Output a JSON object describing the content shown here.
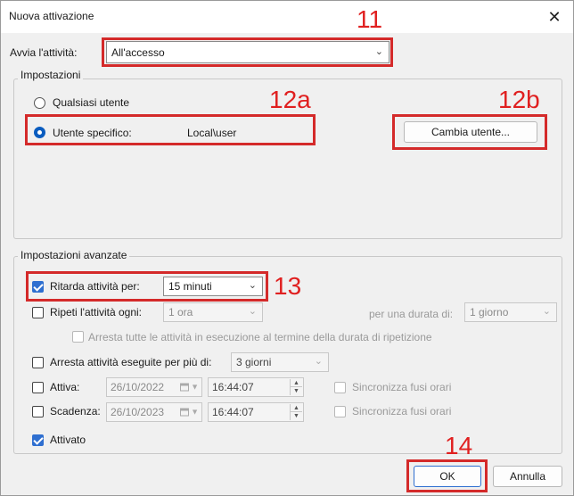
{
  "window": {
    "title": "Nuova attivazione",
    "close_glyph": "✕"
  },
  "start": {
    "label": "Avvia l'attività:",
    "value": "All'accesso"
  },
  "settings": {
    "legend": "Impostazioni",
    "any_user_label": "Qualsiasi utente",
    "specific_user_label": "Utente specifico:",
    "specific_user_value": "Local\\user",
    "change_user_button": "Cambia utente...",
    "selected": "specific_user"
  },
  "advanced": {
    "legend": "Impostazioni avanzate",
    "delay": {
      "label": "Ritarda attività per:",
      "value": "15 minuti",
      "checked": true
    },
    "repeat": {
      "label": "Ripeti l'attività ogni:",
      "value": "1 ora",
      "duration_label": "per una durata di:",
      "duration_value": "1 giorno",
      "checked": false
    },
    "stop_all": {
      "label": "Arresta tutte le attività in esecuzione al termine della durata di ripetizione",
      "checked": false
    },
    "stop_longer": {
      "label": "Arresta attività eseguite per più di:",
      "value": "3 giorni",
      "checked": false
    },
    "activate": {
      "label": "Attiva:",
      "date": "26/10/2022",
      "time": "16:44:07",
      "sync_label": "Sincronizza fusi orari",
      "checked": false
    },
    "expire": {
      "label": "Scadenza:",
      "date": "26/10/2023",
      "time": "16:44:07",
      "sync_label": "Sincronizza fusi orari",
      "checked": false
    },
    "enabled": {
      "label": "Attivato",
      "checked": true
    }
  },
  "buttons": {
    "ok": "OK",
    "cancel": "Annulla"
  },
  "callouts": [
    "11",
    "12a",
    "12b",
    "13",
    "14"
  ],
  "colors": {
    "callout": "#d42a2a",
    "accent": "#2f6fd0",
    "window_bg": "#f0f0f0"
  }
}
